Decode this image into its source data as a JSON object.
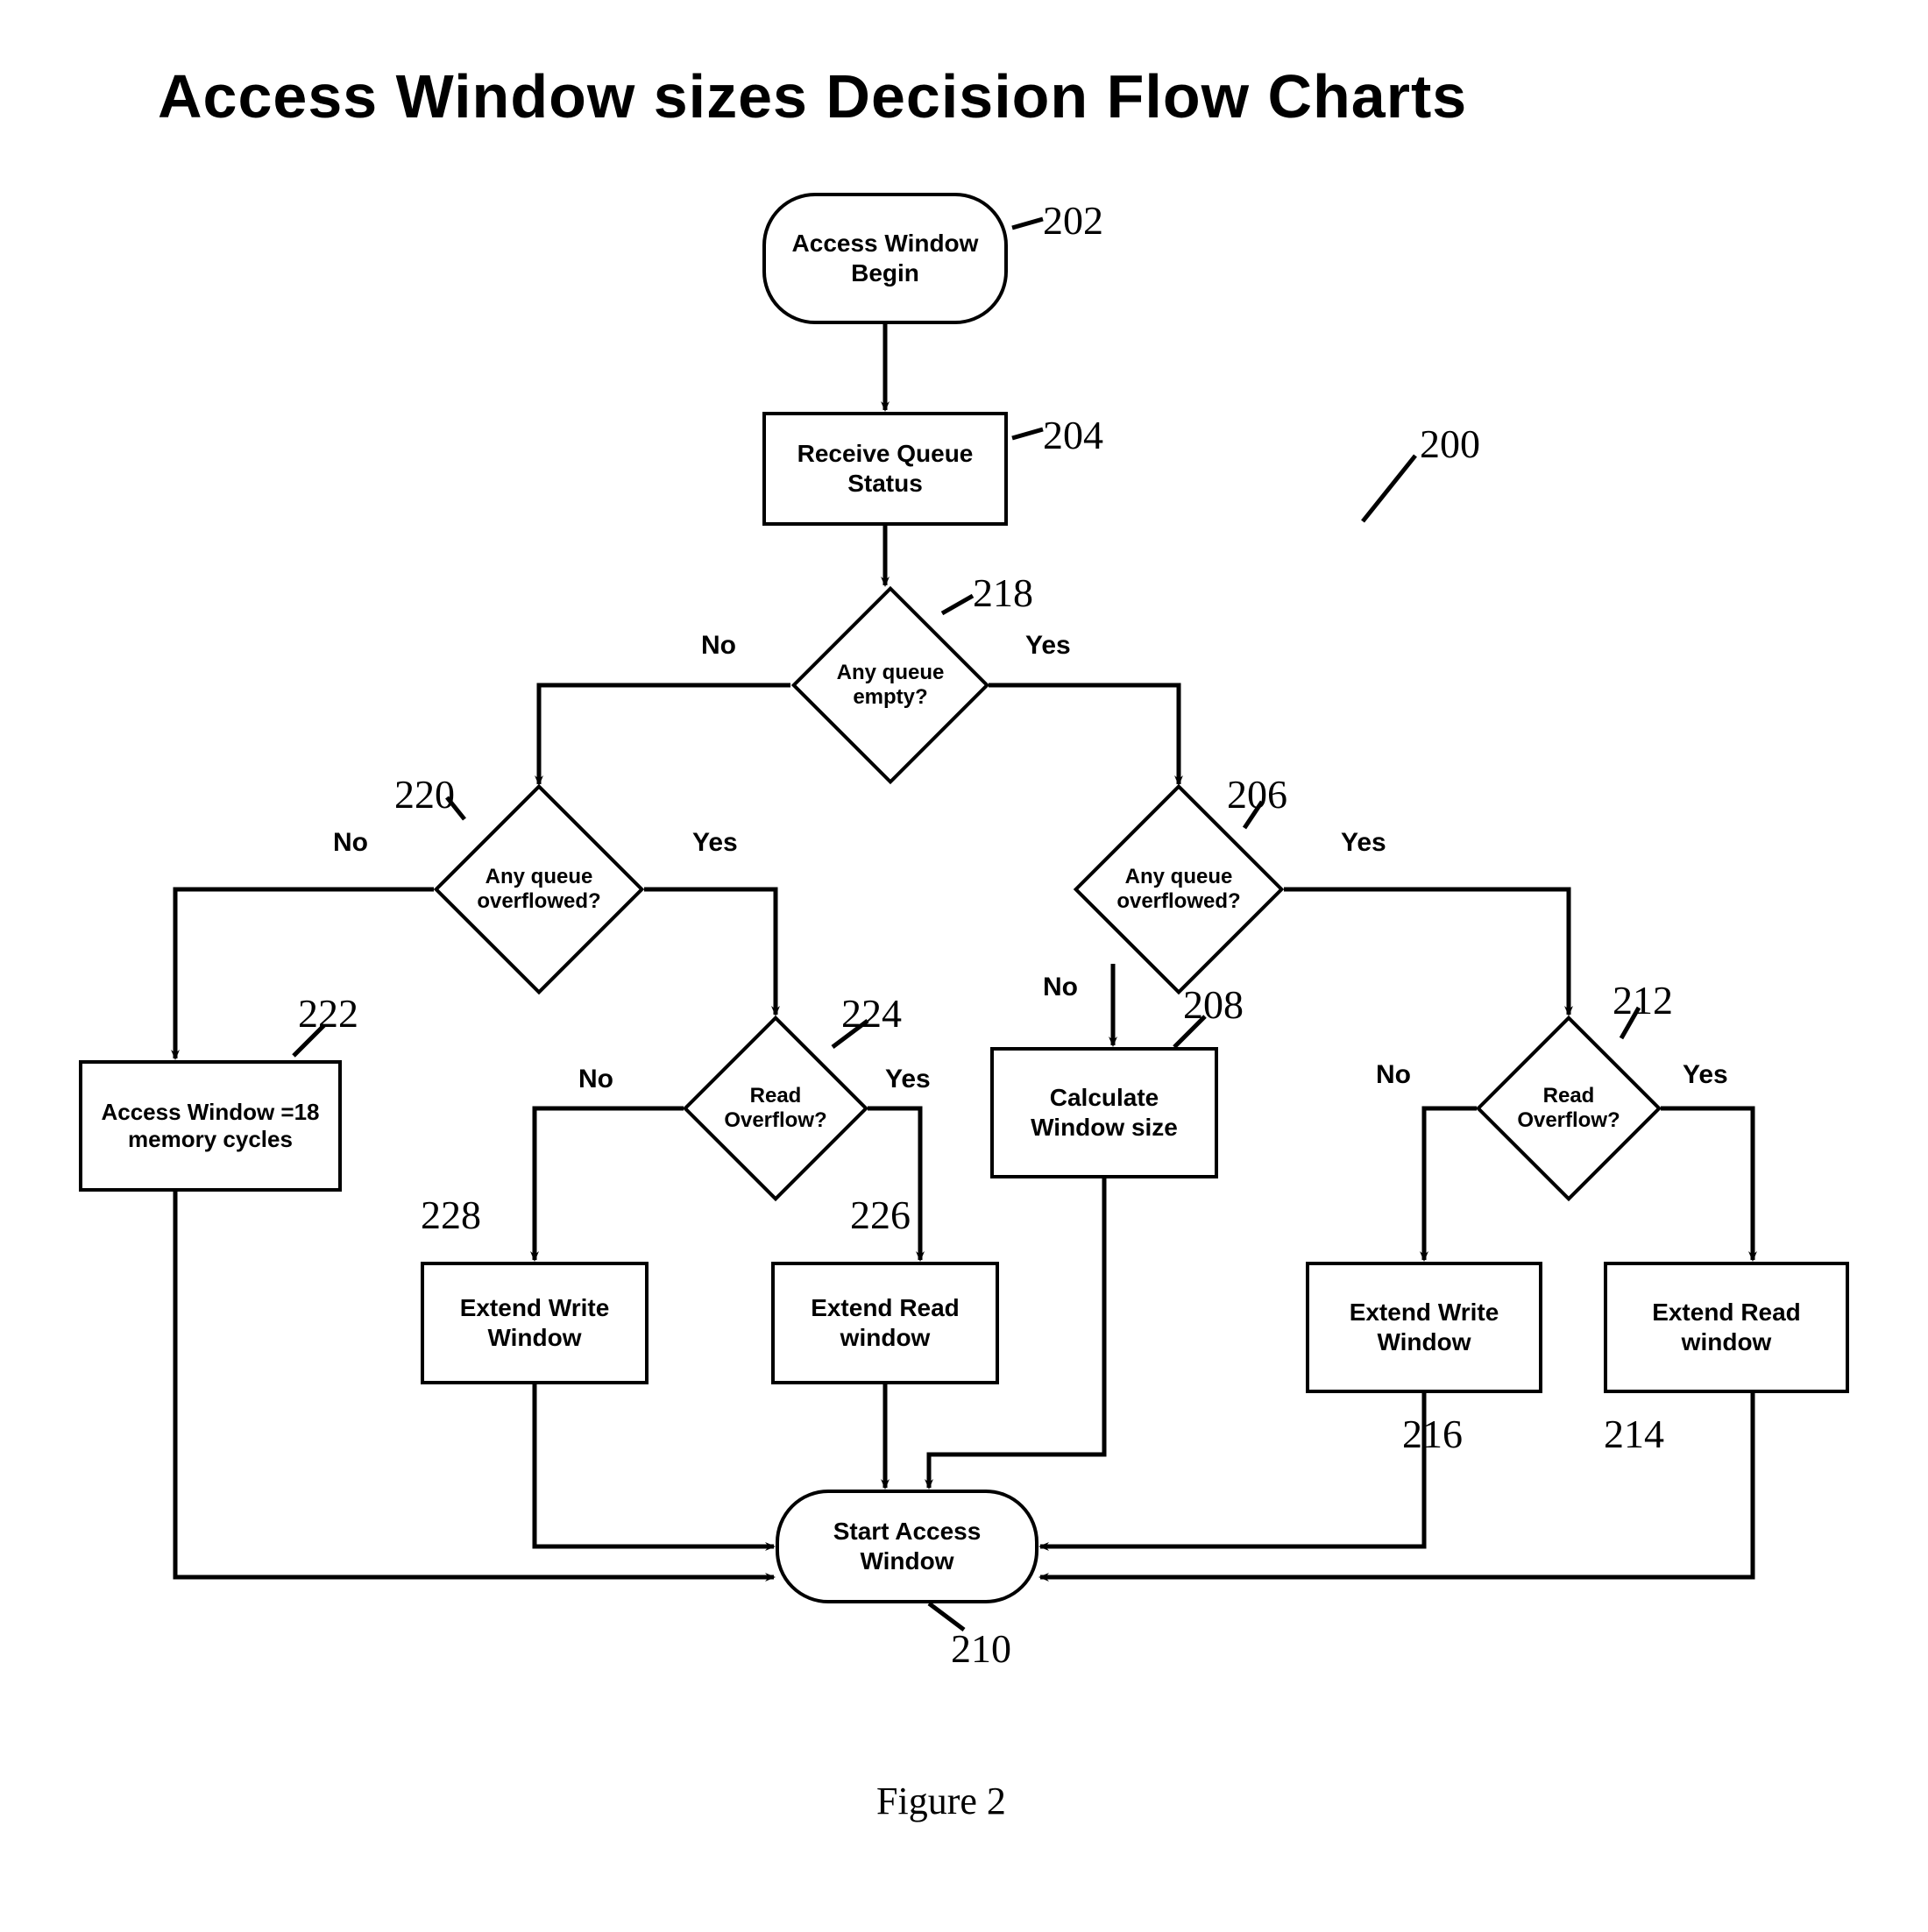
{
  "title": "Access Window sizes Decision  Flow Charts",
  "figure_caption": "Figure 2",
  "figure_ref": "200",
  "nodes": {
    "n202": {
      "text": "Access Window Begin",
      "ref": "202"
    },
    "n204": {
      "text": "Receive Queue Status",
      "ref": "204"
    },
    "n218": {
      "text": "Any queue empty?",
      "ref": "218"
    },
    "n220": {
      "text": "Any queue overflowed?",
      "ref": "220"
    },
    "n206": {
      "text": "Any queue overflowed?",
      "ref": "206"
    },
    "n222": {
      "text": "Access Window =18 memory cycles",
      "ref": "222"
    },
    "n224": {
      "text": "Read Overflow?",
      "ref": "224"
    },
    "n212": {
      "text": "Read Overflow?",
      "ref": "212"
    },
    "n208": {
      "text": "Calculate Window size",
      "ref": "208"
    },
    "n228": {
      "text": "Extend Write Window",
      "ref": "228"
    },
    "n226": {
      "text": "Extend Read window",
      "ref": "226"
    },
    "n216": {
      "text": "Extend Write Window",
      "ref": "216"
    },
    "n214": {
      "text": "Extend Read window",
      "ref": "214"
    },
    "n210": {
      "text": "Start Access Window",
      "ref": "210"
    }
  },
  "edge_labels": {
    "e218_no": "No",
    "e218_yes": "Yes",
    "e220_no": "No",
    "e220_yes": "Yes",
    "e206_no": "No",
    "e206_yes": "Yes",
    "e224_no": "No",
    "e224_yes": "Yes",
    "e212_no": "No",
    "e212_yes": "Yes"
  }
}
